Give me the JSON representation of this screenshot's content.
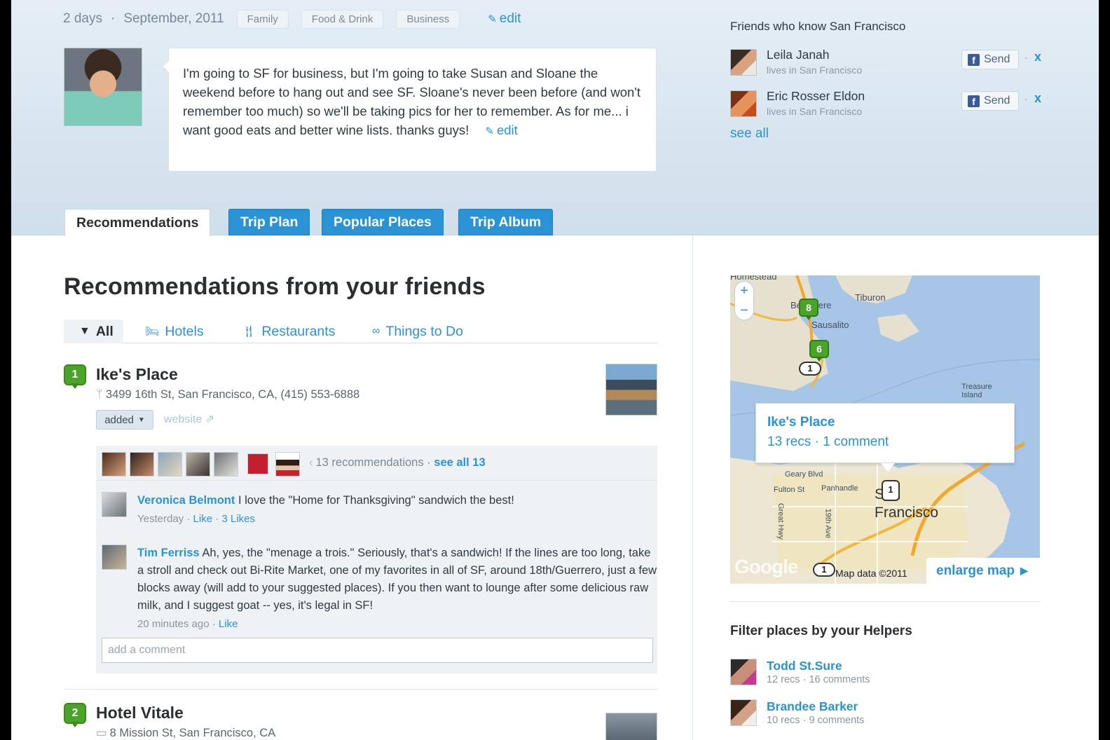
{
  "trip": {
    "duration": "2 days",
    "date": "September, 2011",
    "tags": [
      "Family",
      "Food & Drink",
      "Business"
    ],
    "edit_label": "edit",
    "description": "I'm going to SF for business, but I'm going to take Susan and Sloane the weekend before to hang out and see SF. Sloane's never been before (and won't remember too much) so we'll be taking pics for her to remember. As for me... i want good eats and better wine lists. thanks guys!",
    "description_edit_label": "edit"
  },
  "friends_panel": {
    "title": "Friends who know San Francisco",
    "friends": [
      {
        "name": "Leila Janah",
        "subtitle": "lives in San Francisco",
        "send_label": "Send",
        "remove_label": "x"
      },
      {
        "name": "Eric Rosser Eldon",
        "subtitle": "lives in San Francisco",
        "send_label": "Send",
        "remove_label": "x"
      }
    ],
    "see_all": "see all"
  },
  "tabs": [
    {
      "label": "Recommendations",
      "active": true
    },
    {
      "label": "Trip Plan",
      "active": false
    },
    {
      "label": "Popular Places",
      "active": false
    },
    {
      "label": "Trip Album",
      "active": false
    }
  ],
  "main": {
    "title": "Recommendations from your friends",
    "filters": [
      {
        "label": "All",
        "icon": "pin-icon",
        "active": true
      },
      {
        "label": "Hotels",
        "icon": "bed-icon",
        "active": false
      },
      {
        "label": "Restaurants",
        "icon": "fork-knife-icon",
        "active": false
      },
      {
        "label": "Things to Do",
        "icon": "binoculars-icon",
        "active": false
      }
    ],
    "places": [
      {
        "number": "1",
        "name": "Ike's Place",
        "address": "3499 16th St, San Francisco, CA, (415) 553-6888",
        "added_label": "added",
        "website_label": "website",
        "recs_text": "13 recommendations",
        "see_all_label": "see all 13",
        "comments": [
          {
            "author": "Veronica Belmont",
            "text": "I love the \"Home for Thanksgiving\" sandwich the best!",
            "time": "Yesterday",
            "like_label": "Like",
            "likes": "3 Likes"
          },
          {
            "author": "Tim Ferriss",
            "text": "Ah, yes, the \"menage a trois.\" Seriously, that's a sandwich! If the lines are too long, take a stroll and check out Bi-Rite Market, one of my favorites in all of SF, around 18th/Guerrero, just a few blocks away (will add to your suggested places). If you then want to lounge after some delicious raw milk, and I suggest goat -- yes, it's legal in SF!",
            "time": "20 minutes ago",
            "like_label": "Like"
          }
        ],
        "comment_placeholder": "add a comment"
      },
      {
        "number": "2",
        "name": "Hotel Vitale",
        "address": "8 Mission St, San Francisco, CA"
      }
    ]
  },
  "map": {
    "labels": [
      "Homestead",
      "Tiburon",
      "Belvedere",
      "Sausalito",
      "Treasure Island",
      "Geary Blvd",
      "Fulton St",
      "Panhandle",
      "Great Hwy",
      "19th Ave",
      "San Francisco"
    ],
    "pins": [
      "8",
      "6",
      "1",
      "1",
      "1"
    ],
    "popup": {
      "name": "Ike's Place",
      "recs": "13 recs",
      "comments": "1 comment"
    },
    "logo": "Google",
    "copyright": "Map data ©2011",
    "enlarge_label": "enlarge map",
    "zoom_in": "+",
    "zoom_out": "−"
  },
  "helpers": {
    "title": "Filter places by your Helpers",
    "items": [
      {
        "name": "Todd St.Sure",
        "recs": "12 recs",
        "comments": "16 comments"
      },
      {
        "name": "Brandee Barker",
        "recs": "10 recs",
        "comments": "9 comments"
      }
    ]
  },
  "colors": {
    "accent": "#2a93d5",
    "pin_green": "#4aa42a",
    "header_bg": "#d5e3ee",
    "facebook": "#3b5a9a"
  }
}
